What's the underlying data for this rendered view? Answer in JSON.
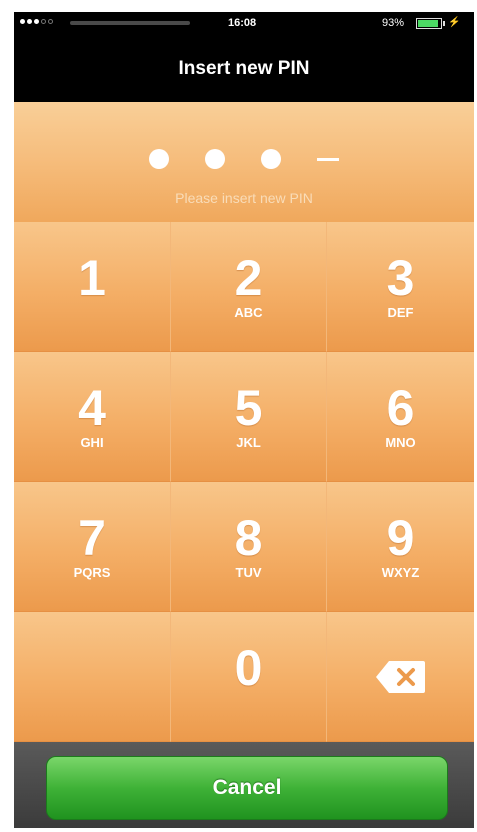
{
  "status_bar": {
    "time": "16:08",
    "battery_percent": "93%",
    "battery_level": 0.93,
    "signal_bars_filled": 3,
    "signal_bars_total": 5
  },
  "nav": {
    "title": "Insert new PIN"
  },
  "pin": {
    "entered_digits": 3,
    "length": 4,
    "prompt": "Please insert new PIN"
  },
  "keypad": {
    "keys": [
      {
        "digit": "1",
        "letters": ""
      },
      {
        "digit": "2",
        "letters": "ABC"
      },
      {
        "digit": "3",
        "letters": "DEF"
      },
      {
        "digit": "4",
        "letters": "GHI"
      },
      {
        "digit": "5",
        "letters": "JKL"
      },
      {
        "digit": "6",
        "letters": "MNO"
      },
      {
        "digit": "7",
        "letters": "PQRS"
      },
      {
        "digit": "8",
        "letters": "TUV"
      },
      {
        "digit": "9",
        "letters": "WXYZ"
      },
      {
        "digit": "0",
        "letters": ""
      }
    ],
    "delete_icon": "backspace-icon"
  },
  "cancel_label": "Cancel",
  "colors": {
    "keypad_orange": "#f4ae66",
    "cancel_green": "#3fb237",
    "nav_black": "#000000"
  }
}
